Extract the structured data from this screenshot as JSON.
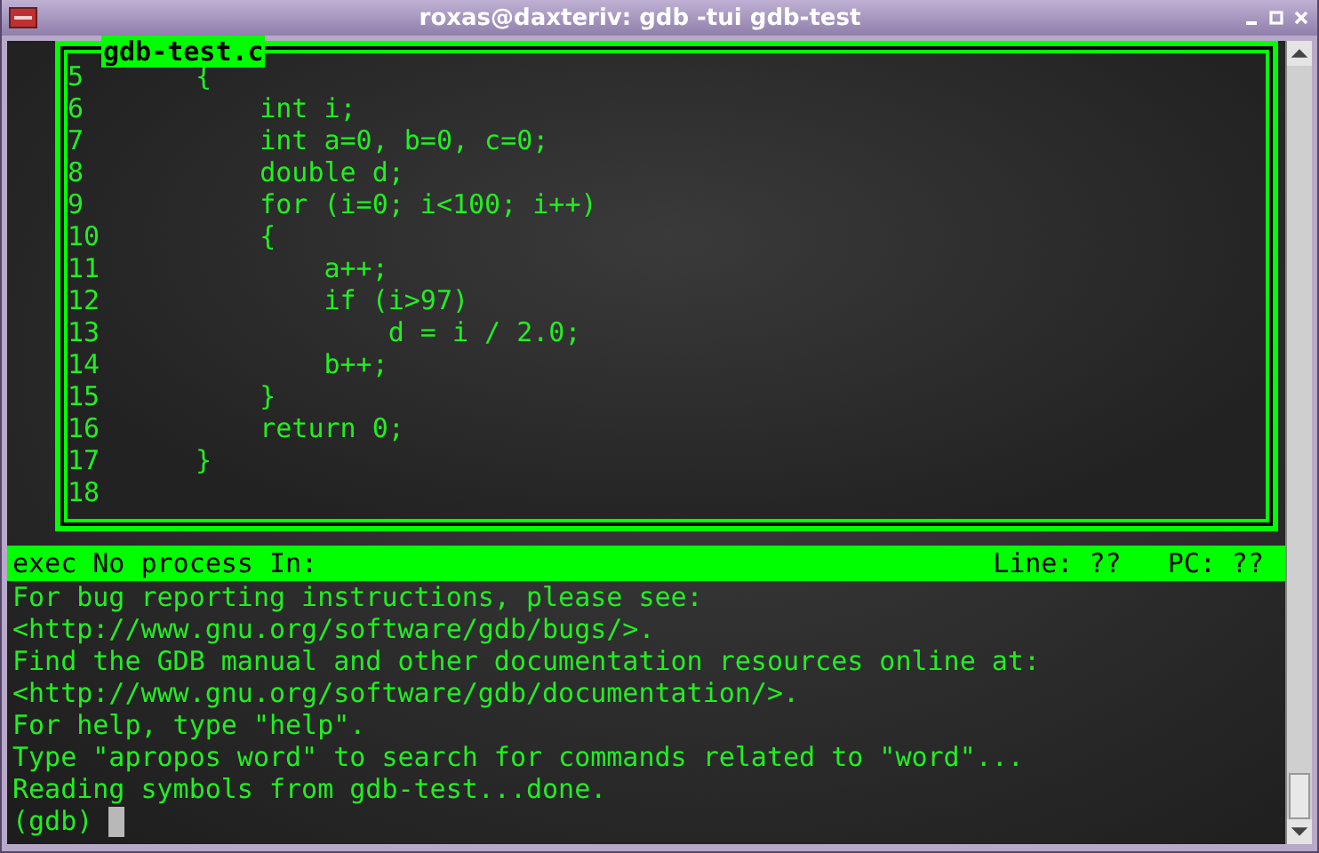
{
  "window": {
    "title": "roxas@daxteriv: gdb -tui gdb-test"
  },
  "source_window": {
    "title": "gdb-test.c",
    "lines": [
      {
        "number": "5",
        "code": "{"
      },
      {
        "number": "6",
        "code": "    int i;"
      },
      {
        "number": "7",
        "code": "    int a=0, b=0, c=0;"
      },
      {
        "number": "8",
        "code": "    double d;"
      },
      {
        "number": "9",
        "code": "    for (i=0; i<100; i++)"
      },
      {
        "number": "10",
        "code": "    {"
      },
      {
        "number": "11",
        "code": "        a++;"
      },
      {
        "number": "12",
        "code": "        if (i>97)"
      },
      {
        "number": "13",
        "code": "            d = i / 2.0;"
      },
      {
        "number": "14",
        "code": "        b++;"
      },
      {
        "number": "15",
        "code": "    }"
      },
      {
        "number": "16",
        "code": "    return 0;"
      },
      {
        "number": "17",
        "code": "}"
      },
      {
        "number": "18"
      }
    ]
  },
  "status_bar": {
    "process": "exec No process In:",
    "line": "Line: ??",
    "pc": "PC: ??"
  },
  "console": {
    "lines": [
      "For bug reporting instructions, please see:",
      "<http://www.gnu.org/software/gdb/bugs/>.",
      "Find the GDB manual and other documentation resources online at:",
      "<http://www.gnu.org/software/gdb/documentation/>.",
      "For help, type \"help\".",
      "Type \"apropos word\" to search for commands related to \"word\"...",
      "Reading symbols from gdb-test...done."
    ],
    "prompt": "(gdb)"
  }
}
